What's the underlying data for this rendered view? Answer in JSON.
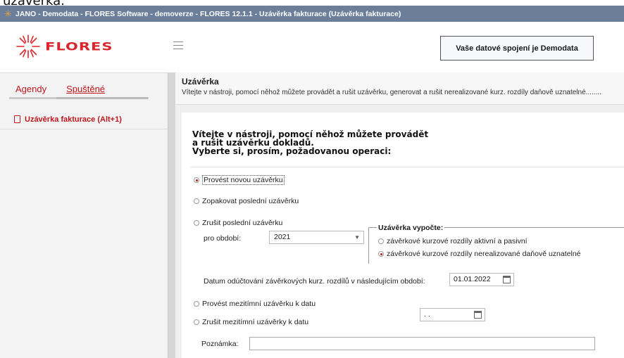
{
  "crop_text": "uzávěrka.",
  "window": {
    "title": "JANO - Demodata - FLORES Software - demoverze - FLORES 12.1.1 - Uzávěrka fakturace  (Uzávěrka fakturace)",
    "icon": "flores-sun-icon"
  },
  "header": {
    "logo_text": "FLORES",
    "connection_label": "Vaše datové spojení je Demodata",
    "menu_icon": "hamburger-icon"
  },
  "sidebar": {
    "tabs": [
      {
        "label": "Agendy",
        "active": false
      },
      {
        "label": "Spuštěné",
        "active": true
      }
    ],
    "items": [
      {
        "label": "Uzávěrka fakturace (Alt+1)",
        "icon": "document-icon"
      }
    ]
  },
  "main": {
    "title": "Uzávěrka",
    "description": "Vítejte v nástroji, pomocí něhož můžete provádět a rušit uzávěrku, generovat a rušit nerealizované kurz. rozdíly daňově uznatelné........",
    "intro_lines": [
      "Vítejte v nástroji, pomocí něhož můžete provádět",
      "a rušit uzávěrku dokladů.",
      "Vyberte si, prosím, požadovanou operaci:"
    ],
    "options": {
      "new_closing": "Provést novou uzávěrku",
      "repeat_last": "Zopakovat poslední uzávěrku",
      "cancel_last": "Zrušit poslední uzávěrku",
      "interim_closing": "Provést mezitímní uzávěrku k datu",
      "cancel_interim": "Zrušit mezitímní uzávěrky k datu"
    },
    "selected_option": "new_closing",
    "period_label": "pro období:",
    "period_value": "2021",
    "calc_group": {
      "title": "Uzávěrka vypočte:",
      "options": [
        {
          "label": "závěrkové kurzové rozdíly aktivní a pasivní",
          "checked": false
        },
        {
          "label": "závěrkové kurzové rozdíly nerealizované daňově uznatelné",
          "checked": true
        }
      ]
    },
    "posting_date_label": "Datum odúčtování závěrkových kurz. rozdílů v následujícím období:",
    "posting_date_value": "01.01.2022",
    "interim_date_value": " . .",
    "note_label": "Poznámka:",
    "note_value": ""
  },
  "colors": {
    "brand_red": "#d9252d",
    "accent_red": "#c0161d",
    "titlebar": "#6b7f9a"
  }
}
